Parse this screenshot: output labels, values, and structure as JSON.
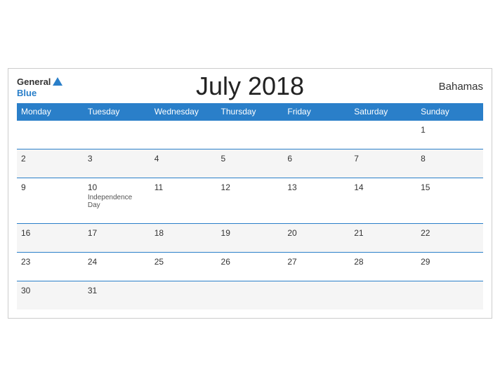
{
  "header": {
    "title": "July 2018",
    "country": "Bahamas",
    "logo": {
      "line1_general": "General",
      "line2_blue": "Blue"
    }
  },
  "weekdays": [
    "Monday",
    "Tuesday",
    "Wednesday",
    "Thursday",
    "Friday",
    "Saturday",
    "Sunday"
  ],
  "weeks": [
    [
      {
        "day": "",
        "event": ""
      },
      {
        "day": "",
        "event": ""
      },
      {
        "day": "",
        "event": ""
      },
      {
        "day": "",
        "event": ""
      },
      {
        "day": "",
        "event": ""
      },
      {
        "day": "",
        "event": ""
      },
      {
        "day": "1",
        "event": ""
      }
    ],
    [
      {
        "day": "2",
        "event": ""
      },
      {
        "day": "3",
        "event": ""
      },
      {
        "day": "4",
        "event": ""
      },
      {
        "day": "5",
        "event": ""
      },
      {
        "day": "6",
        "event": ""
      },
      {
        "day": "7",
        "event": ""
      },
      {
        "day": "8",
        "event": ""
      }
    ],
    [
      {
        "day": "9",
        "event": ""
      },
      {
        "day": "10",
        "event": "Independence Day"
      },
      {
        "day": "11",
        "event": ""
      },
      {
        "day": "12",
        "event": ""
      },
      {
        "day": "13",
        "event": ""
      },
      {
        "day": "14",
        "event": ""
      },
      {
        "day": "15",
        "event": ""
      }
    ],
    [
      {
        "day": "16",
        "event": ""
      },
      {
        "day": "17",
        "event": ""
      },
      {
        "day": "18",
        "event": ""
      },
      {
        "day": "19",
        "event": ""
      },
      {
        "day": "20",
        "event": ""
      },
      {
        "day": "21",
        "event": ""
      },
      {
        "day": "22",
        "event": ""
      }
    ],
    [
      {
        "day": "23",
        "event": ""
      },
      {
        "day": "24",
        "event": ""
      },
      {
        "day": "25",
        "event": ""
      },
      {
        "day": "26",
        "event": ""
      },
      {
        "day": "27",
        "event": ""
      },
      {
        "day": "28",
        "event": ""
      },
      {
        "day": "29",
        "event": ""
      }
    ],
    [
      {
        "day": "30",
        "event": ""
      },
      {
        "day": "31",
        "event": ""
      },
      {
        "day": "",
        "event": ""
      },
      {
        "day": "",
        "event": ""
      },
      {
        "day": "",
        "event": ""
      },
      {
        "day": "",
        "event": ""
      },
      {
        "day": "",
        "event": ""
      }
    ]
  ],
  "colors": {
    "header_bg": "#2a7fc9",
    "border": "#2a7fc9",
    "odd_row": "#ffffff",
    "even_row": "#f5f5f5"
  }
}
